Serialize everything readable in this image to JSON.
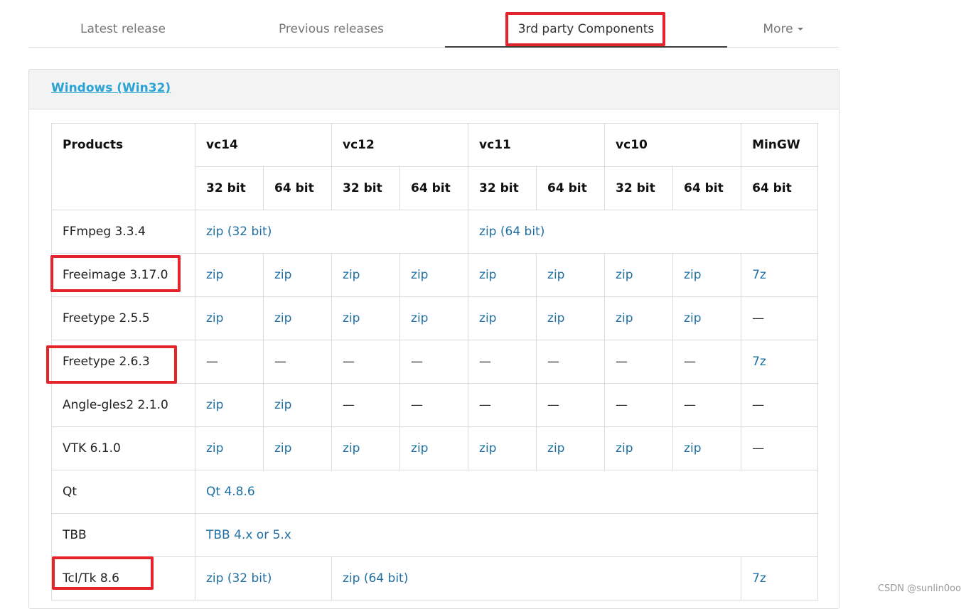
{
  "tabs": [
    {
      "label": "Latest release"
    },
    {
      "label": "Previous releases"
    },
    {
      "label": "3rd party Components"
    },
    {
      "label": "More"
    }
  ],
  "panel": {
    "title": "Windows (Win32)"
  },
  "table": {
    "header": {
      "products": "Products",
      "groups": [
        "vc14",
        "vc12",
        "vc11",
        "vc10",
        "MinGW"
      ],
      "bits": [
        "32 bit",
        "64 bit",
        "32 bit",
        "64 bit",
        "32 bit",
        "64 bit",
        "32 bit",
        "64 bit",
        "64 bit"
      ]
    },
    "rows": [
      {
        "product": "FFmpeg 3.3.4",
        "a": "zip (32 bit)",
        "b": "zip (64 bit)"
      },
      {
        "product": "Freeimage 3.17.0",
        "cells": [
          "zip",
          "zip",
          "zip",
          "zip",
          "zip",
          "zip",
          "zip",
          "zip",
          "7z"
        ]
      },
      {
        "product": "Freetype 2.5.5",
        "cells": [
          "zip",
          "zip",
          "zip",
          "zip",
          "zip",
          "zip",
          "zip",
          "zip",
          "—"
        ]
      },
      {
        "product": "Freetype 2.6.3",
        "cells": [
          "—",
          "—",
          "—",
          "—",
          "—",
          "—",
          "—",
          "—",
          "7z"
        ]
      },
      {
        "product": "Angle-gles2 2.1.0",
        "cells": [
          "zip",
          "zip",
          "—",
          "—",
          "—",
          "—",
          "—",
          "—",
          "—"
        ]
      },
      {
        "product": "VTK 6.1.0",
        "cells": [
          "zip",
          "zip",
          "zip",
          "zip",
          "zip",
          "zip",
          "zip",
          "zip",
          "—"
        ]
      },
      {
        "product": "Qt",
        "a": "Qt 4.8.6"
      },
      {
        "product": "TBB",
        "a": "TBB 4.x or 5.x"
      },
      {
        "product": "Tcl/Tk 8.6",
        "a": "zip (32 bit)",
        "b": "zip (64 bit)",
        "c": "7z"
      }
    ]
  },
  "watermark": "CSDN @sunlin0oo",
  "colors": {
    "highlight": "#e3242b",
    "link": "#1f6fa3",
    "panel_title": "#2aa4d5"
  }
}
